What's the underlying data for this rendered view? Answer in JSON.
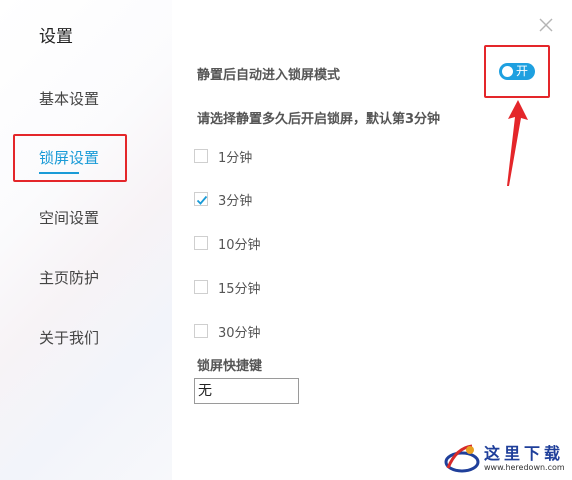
{
  "sidebar": {
    "title": "设置",
    "items": [
      {
        "label": "基本设置"
      },
      {
        "label": "锁屏设置"
      },
      {
        "label": "空间设置"
      },
      {
        "label": "主页防护"
      },
      {
        "label": "关于我们"
      }
    ],
    "active_index": 1
  },
  "main": {
    "auto_lock_label": "静置后自动进入锁屏模式",
    "toggle": {
      "label": "开",
      "on": true
    },
    "idle_prompt": "请选择静置多久后开启锁屏，默认第3分钟",
    "options": [
      {
        "label": "1分钟",
        "checked": false
      },
      {
        "label": "3分钟",
        "checked": true
      },
      {
        "label": "10分钟",
        "checked": false
      },
      {
        "label": "15分钟",
        "checked": false
      },
      {
        "label": "30分钟",
        "checked": false
      }
    ],
    "hotkey_label": "锁屏快捷键",
    "hotkey_value": "无"
  },
  "watermark": {
    "text": "这里下载",
    "url": "www.heredown.com"
  },
  "colors": {
    "accent": "#1a9bd7",
    "highlight_box": "#e4262a"
  }
}
